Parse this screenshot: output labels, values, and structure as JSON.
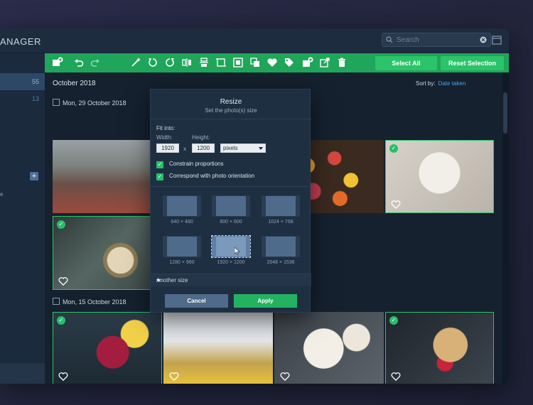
{
  "app": {
    "title": "ANAGER"
  },
  "search": {
    "placeholder": "Search",
    "value": ""
  },
  "sidebar": {
    "counts": [
      "55",
      "13"
    ],
    "extra_text": "e"
  },
  "toolbar": {
    "icons": [
      "add-photo-icon",
      "undo-icon",
      "redo-icon",
      "magic-wand-icon",
      "rotate-left-icon",
      "rotate-right-icon",
      "flip-horizontal-icon",
      "flip-vertical-icon",
      "crop-icon",
      "resize-icon",
      "watermark-icon",
      "heart-icon",
      "tag-icon",
      "add-to-album-icon",
      "share-icon",
      "delete-icon"
    ],
    "select_all": "Select All",
    "reset_selection": "Reset Selection",
    "accent": "#1fa65a"
  },
  "gallery": {
    "month": "October 2018",
    "sort_label": "Sort by:",
    "sort_value": "Date taken",
    "groups": [
      {
        "date": "Mon, 29 October 2018"
      },
      {
        "date": "Mon, 15 October 2018"
      }
    ]
  },
  "dialog": {
    "title": "Resize",
    "subtitle": "Set the photo(s) size",
    "fit_into": "Fit into:",
    "width_label": "Width:",
    "height_label": "Height:",
    "width_value": "1920",
    "times": "x",
    "height_value": "1200",
    "unit": "pixels",
    "options": [
      "Constrain proportions",
      "Correspond with photo orientation"
    ],
    "presets": [
      "640 × 480",
      "800 × 600",
      "1024 × 768",
      "1280 × 960",
      "1920 × 1200",
      "2048 × 1536"
    ],
    "selected_preset": "1920 × 1200",
    "another_size": "Another size",
    "cancel": "Cancel",
    "apply": "Apply"
  }
}
